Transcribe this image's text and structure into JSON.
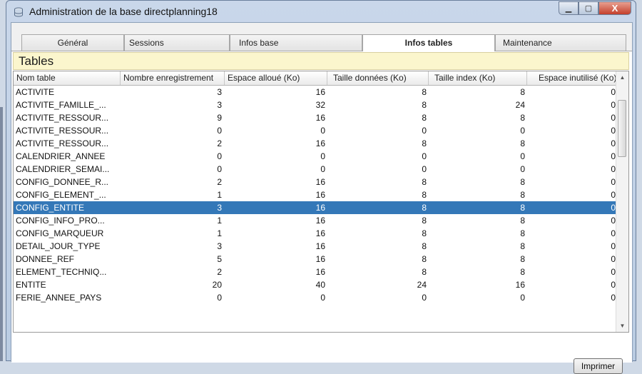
{
  "window": {
    "title": "Administration de la base directplanning18",
    "minimize_symbol": "▁",
    "maximize_symbol": "▢",
    "close_symbol": "X"
  },
  "tabs": [
    {
      "label": "Général"
    },
    {
      "label": "Sessions"
    },
    {
      "label": "Infos base"
    },
    {
      "label": "Infos tables",
      "active": true
    },
    {
      "label": "Maintenance"
    }
  ],
  "section": {
    "title": "Tables"
  },
  "table": {
    "columns": [
      "Nom table",
      "Nombre enregistrement",
      "Espace alloué (Ko)",
      "Taille données (Ko)",
      "Taille index (Ko)",
      "Espace inutilisé (Ko)"
    ],
    "rows": [
      [
        "ACTIVITE",
        "3",
        "16",
        "8",
        "8",
        "0"
      ],
      [
        "ACTIVITE_FAMILLE_...",
        "3",
        "32",
        "8",
        "24",
        "0"
      ],
      [
        "ACTIVITE_RESSOUR...",
        "9",
        "16",
        "8",
        "8",
        "0"
      ],
      [
        "ACTIVITE_RESSOUR...",
        "0",
        "0",
        "0",
        "0",
        "0"
      ],
      [
        "ACTIVITE_RESSOUR...",
        "2",
        "16",
        "8",
        "8",
        "0"
      ],
      [
        "CALENDRIER_ANNEE",
        "0",
        "0",
        "0",
        "0",
        "0"
      ],
      [
        "CALENDRIER_SEMAI...",
        "0",
        "0",
        "0",
        "0",
        "0"
      ],
      [
        "CONFIG_DONNEE_R...",
        "2",
        "16",
        "8",
        "8",
        "0"
      ],
      [
        "CONFIG_ELEMENT_...",
        "1",
        "16",
        "8",
        "8",
        "0"
      ],
      [
        "CONFIG_ENTITE",
        "3",
        "16",
        "8",
        "8",
        "0"
      ],
      [
        "CONFIG_INFO_PRO...",
        "1",
        "16",
        "8",
        "8",
        "0"
      ],
      [
        "CONFIG_MARQUEUR",
        "1",
        "16",
        "8",
        "8",
        "0"
      ],
      [
        "DETAIL_JOUR_TYPE",
        "3",
        "16",
        "8",
        "8",
        "0"
      ],
      [
        "DONNEE_REF",
        "5",
        "16",
        "8",
        "8",
        "0"
      ],
      [
        "ELEMENT_TECHNIQ...",
        "2",
        "16",
        "8",
        "8",
        "0"
      ],
      [
        "ENTITE",
        "20",
        "40",
        "24",
        "16",
        "0"
      ],
      [
        "FERIE_ANNEE_PAYS",
        "0",
        "0",
        "0",
        "0",
        "0"
      ]
    ],
    "selected_row_index": 9
  },
  "scrollbar": {
    "up_symbol": "▲",
    "down_symbol": "▼"
  },
  "buttons": {
    "print_label": "Imprimer"
  },
  "colors": {
    "selection": "#3478b8",
    "section_header_bg": "#fbf6cd"
  }
}
